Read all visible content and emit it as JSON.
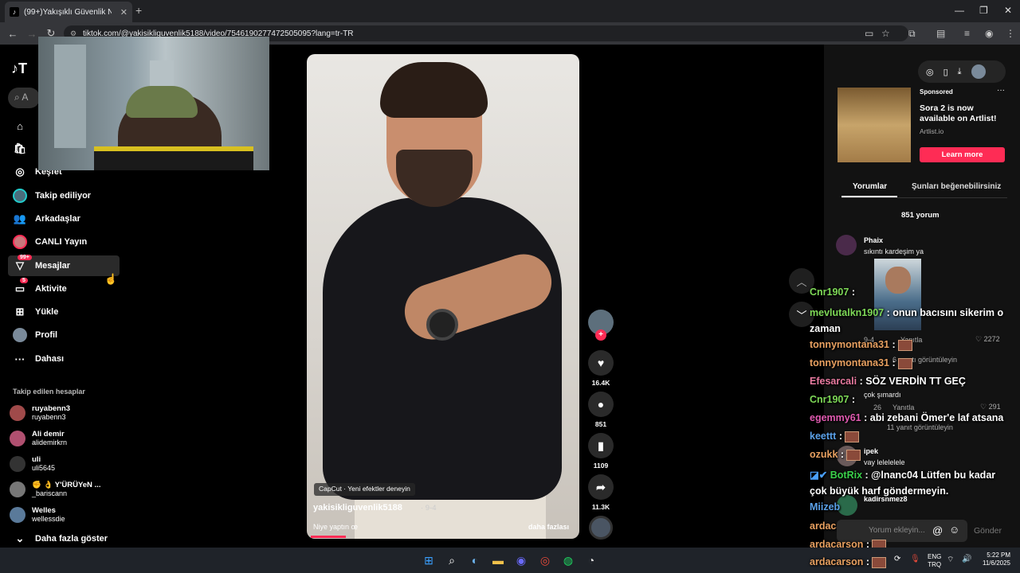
{
  "browser": {
    "tab_title": "(99+)Yakışıklı Güvenlik Neden",
    "url": "tiktok.com/@yakisikliguvenlik5188/video/7546190277472505095?lang=tr-TR"
  },
  "sidebar": {
    "search_placeholder": "A",
    "items": [
      {
        "label": "Keşfet",
        "icon": "compass-icon"
      },
      {
        "label": "Takip ediliyor",
        "icon": "avatar-icon"
      },
      {
        "label": "Arkadaşlar",
        "icon": "friends-icon"
      },
      {
        "label": "CANLI Yayın",
        "icon": "live-icon"
      },
      {
        "label": "Mesajlar",
        "icon": "message-icon",
        "badge": "99+"
      },
      {
        "label": "Aktivite",
        "icon": "activity-icon",
        "badge": "5"
      },
      {
        "label": "Yükle",
        "icon": "upload-icon"
      },
      {
        "label": "Profil",
        "icon": "profile-icon"
      },
      {
        "label": "Dahası",
        "icon": "more-icon"
      }
    ],
    "following_header": "Takip edilen hesaplar",
    "following": [
      {
        "name": "ruyabenn3",
        "handle": "ruyabenn3"
      },
      {
        "name": "Ali demir",
        "handle": "alidemirkrn"
      },
      {
        "name": "uli",
        "handle": "uli5645"
      },
      {
        "name": "✊ 👌 Y'ÜRÜYeN ...",
        "handle": "_bariscann"
      },
      {
        "name": "Welles",
        "handle": "wellessdie"
      }
    ],
    "show_more": "Daha fazla göster"
  },
  "video": {
    "capcut_label": "CapCut · Yeni efektler deneyin",
    "author": "yakisikliguvenlik5188",
    "date": "· 9-4",
    "caption": "Niye yaptın œ",
    "more": "daha fazlası",
    "progress": 0.13
  },
  "actions": {
    "likes": "16.4K",
    "comments": "851",
    "saves": "1109",
    "shares": "11.3K"
  },
  "ad": {
    "sponsored": "Sponsored",
    "title": "Sora 2 is now available on Artlist!",
    "domain": "Artlist.io",
    "button": "Learn more"
  },
  "comments_panel": {
    "tab_comments": "Yorumlar",
    "tab_like": "Şunları beğenebilirsiniz",
    "count": "851 yorum",
    "comments": [
      {
        "user": "Phaix",
        "text": "sıkıntı kardeşim ya",
        "date": "9-4",
        "reply": "Yanıtla",
        "likes": "2272",
        "view_replies": "6 yanıtı görüntüleyin"
      },
      {
        "user": "",
        "text": "çok şımardı",
        "date": "26",
        "reply": "Yanıtla",
        "likes": "291",
        "view_replies": "11 yanıt görüntüleyin"
      },
      {
        "user": "ipek",
        "text": "vay lelelelele"
      },
      {
        "user": "kadirsnmez8",
        "text": "..."
      }
    ],
    "input_placeholder": "Yorum ekleyin...",
    "send": "Gönder"
  },
  "chat": [
    {
      "user": "Cnr1907",
      "color": "#7ed957",
      "text": ":"
    },
    {
      "user": "mevlutalkn1907",
      "color": "#7ed957",
      "text": ": onun bacısını sikerim o zaman"
    },
    {
      "user": "tonnymontana31",
      "color": "#e8a060",
      "text": ":"
    },
    {
      "user": "tonnymontana31",
      "color": "#e8a060",
      "text": ":"
    },
    {
      "user": "Efesarcali",
      "color": "#e87aa0",
      "text": ": SÖZ VERDİN TT GEÇ"
    },
    {
      "user": "Cnr1907",
      "color": "#7ed957",
      "text": ":"
    },
    {
      "user": "egemmy61",
      "color": "#e05ab0",
      "text": ": abi zebani Ömer'e laf atsana"
    },
    {
      "user": "keettt",
      "color": "#5aa0e8",
      "text": ":"
    },
    {
      "user": "ozukk",
      "color": "#e8a060",
      "text": ":"
    },
    {
      "user": "BotRix",
      "color": "#3ad04a",
      "text": ": @lnanc04 Lütfen bu kadar çok büyük harf göndermeyin."
    },
    {
      "user": "Miizeb",
      "color": "#5aa0e8",
      "text": ""
    },
    {
      "user": "ardacarson",
      "color": "#e8a060",
      "text": ":"
    },
    {
      "user": "ardacarson",
      "color": "#e8a060",
      "text": ":"
    },
    {
      "user": "ardacarson",
      "color": "#e8a060",
      "text": ":"
    }
  ],
  "system": {
    "lang1": "ENG",
    "lang2": "TRQ",
    "time": "5:22 PM",
    "date": "11/6/2025"
  },
  "colors": {
    "accent": "#fe2c55",
    "panel": "#121212"
  }
}
